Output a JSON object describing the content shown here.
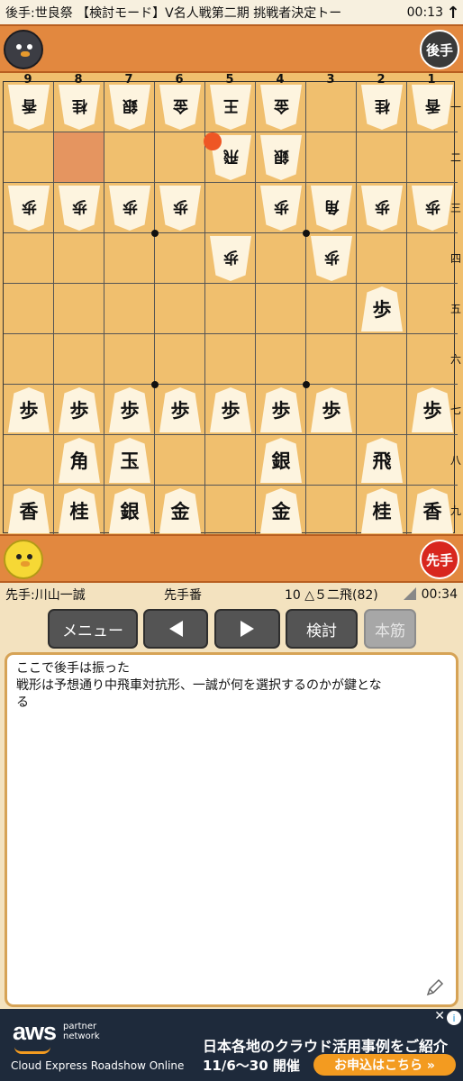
{
  "top_bar": {
    "title": "後手:世良祭 【検討モード】V名人戦第二期 挑戦者決定トー",
    "time": "00:13"
  },
  "gote_player": {
    "avatar_icon": "crow-icon",
    "role": "後手"
  },
  "sente_player": {
    "avatar_icon": "chick-icon",
    "role": "先手"
  },
  "board": {
    "file_labels": [
      "9",
      "8",
      "7",
      "6",
      "5",
      "4",
      "3",
      "2",
      "1"
    ],
    "rank_labels": [
      "一",
      "二",
      "三",
      "四",
      "五",
      "六",
      "七",
      "八",
      "九"
    ],
    "last_move_square": [
      8,
      2
    ],
    "move_marker_square": [
      5,
      2
    ],
    "pieces": [
      {
        "file": 9,
        "rank": 1,
        "kanji": "香",
        "owner": "gote"
      },
      {
        "file": 8,
        "rank": 1,
        "kanji": "桂",
        "owner": "gote"
      },
      {
        "file": 7,
        "rank": 1,
        "kanji": "銀",
        "owner": "gote"
      },
      {
        "file": 6,
        "rank": 1,
        "kanji": "金",
        "owner": "gote"
      },
      {
        "file": 5,
        "rank": 1,
        "kanji": "王",
        "owner": "gote"
      },
      {
        "file": 4,
        "rank": 1,
        "kanji": "金",
        "owner": "gote"
      },
      {
        "file": 2,
        "rank": 1,
        "kanji": "桂",
        "owner": "gote"
      },
      {
        "file": 1,
        "rank": 1,
        "kanji": "香",
        "owner": "gote"
      },
      {
        "file": 5,
        "rank": 2,
        "kanji": "飛",
        "owner": "gote"
      },
      {
        "file": 4,
        "rank": 2,
        "kanji": "銀",
        "owner": "gote"
      },
      {
        "file": 9,
        "rank": 3,
        "kanji": "歩",
        "owner": "gote"
      },
      {
        "file": 8,
        "rank": 3,
        "kanji": "歩",
        "owner": "gote"
      },
      {
        "file": 7,
        "rank": 3,
        "kanji": "歩",
        "owner": "gote"
      },
      {
        "file": 6,
        "rank": 3,
        "kanji": "歩",
        "owner": "gote"
      },
      {
        "file": 4,
        "rank": 3,
        "kanji": "歩",
        "owner": "gote"
      },
      {
        "file": 3,
        "rank": 3,
        "kanji": "角",
        "owner": "gote"
      },
      {
        "file": 2,
        "rank": 3,
        "kanji": "歩",
        "owner": "gote"
      },
      {
        "file": 1,
        "rank": 3,
        "kanji": "歩",
        "owner": "gote"
      },
      {
        "file": 5,
        "rank": 4,
        "kanji": "歩",
        "owner": "gote"
      },
      {
        "file": 3,
        "rank": 4,
        "kanji": "歩",
        "owner": "gote"
      },
      {
        "file": 2,
        "rank": 5,
        "kanji": "歩",
        "owner": "sente"
      },
      {
        "file": 9,
        "rank": 7,
        "kanji": "歩",
        "owner": "sente"
      },
      {
        "file": 8,
        "rank": 7,
        "kanji": "歩",
        "owner": "sente"
      },
      {
        "file": 7,
        "rank": 7,
        "kanji": "歩",
        "owner": "sente"
      },
      {
        "file": 6,
        "rank": 7,
        "kanji": "歩",
        "owner": "sente"
      },
      {
        "file": 5,
        "rank": 7,
        "kanji": "歩",
        "owner": "sente"
      },
      {
        "file": 4,
        "rank": 7,
        "kanji": "歩",
        "owner": "sente"
      },
      {
        "file": 3,
        "rank": 7,
        "kanji": "歩",
        "owner": "sente"
      },
      {
        "file": 1,
        "rank": 7,
        "kanji": "歩",
        "owner": "sente"
      },
      {
        "file": 8,
        "rank": 8,
        "kanji": "角",
        "owner": "sente"
      },
      {
        "file": 7,
        "rank": 8,
        "kanji": "玉",
        "owner": "sente"
      },
      {
        "file": 4,
        "rank": 8,
        "kanji": "銀",
        "owner": "sente"
      },
      {
        "file": 2,
        "rank": 8,
        "kanji": "飛",
        "owner": "sente"
      },
      {
        "file": 9,
        "rank": 9,
        "kanji": "香",
        "owner": "sente"
      },
      {
        "file": 8,
        "rank": 9,
        "kanji": "桂",
        "owner": "sente"
      },
      {
        "file": 7,
        "rank": 9,
        "kanji": "銀",
        "owner": "sente"
      },
      {
        "file": 6,
        "rank": 9,
        "kanji": "金",
        "owner": "sente"
      },
      {
        "file": 4,
        "rank": 9,
        "kanji": "金",
        "owner": "sente"
      },
      {
        "file": 2,
        "rank": 9,
        "kanji": "桂",
        "owner": "sente"
      },
      {
        "file": 1,
        "rank": 9,
        "kanji": "香",
        "owner": "sente"
      }
    ]
  },
  "info_row": {
    "sente_player": "先手:川山一誠",
    "turn": "先手番",
    "move": "10 △５二飛(82)",
    "clock": "00:34"
  },
  "buttons": {
    "menu": "メニュー",
    "prev_icon": "prev-arrow-icon",
    "next_icon": "next-arrow-icon",
    "analyze": "検討",
    "mainline": "本筋"
  },
  "comment": {
    "line1": "ここで後手は振った",
    "line2": "戦形は予想通り中飛車対抗形、一誠が何を選択するのかが鍵とな",
    "line3": "る"
  },
  "ad": {
    "brand": "aws",
    "partner": "partner network",
    "event": "Cloud Express Roadshow Online",
    "headline": "日本各地のクラウド活用事例をご紹介",
    "dates": "11/6～30 開催",
    "cta": "お申込はこちら »",
    "colors": {
      "background": "#1e2a3b",
      "accent": "#f39b20"
    }
  }
}
